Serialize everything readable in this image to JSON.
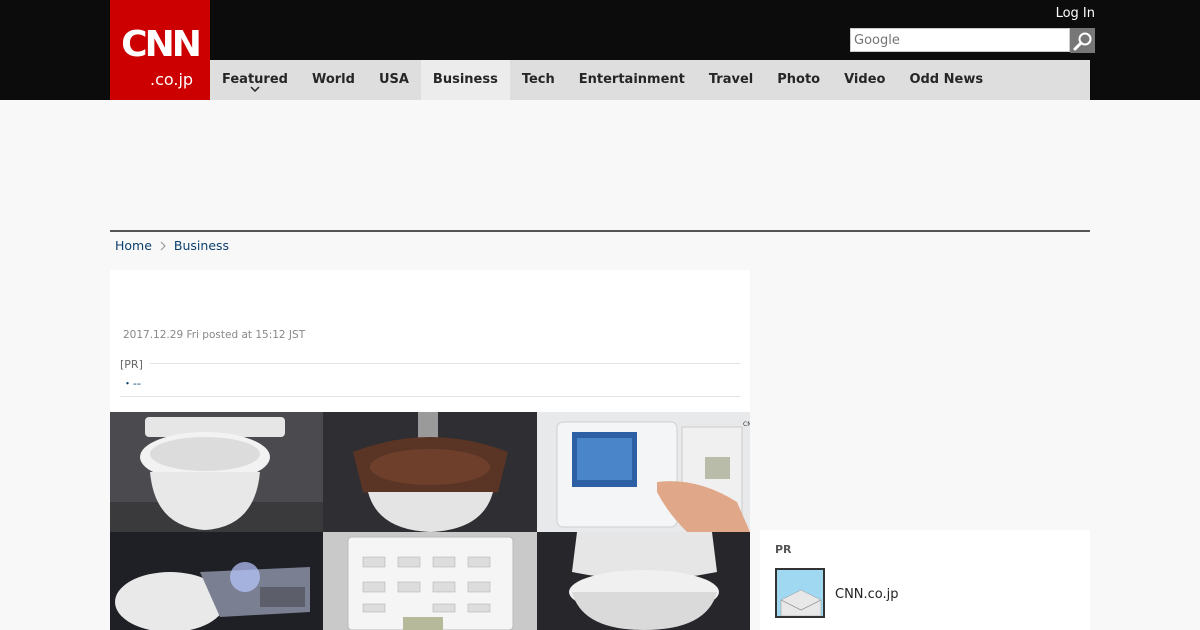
{
  "header": {
    "logo_main": "CNN",
    "logo_sub": ".co.jp",
    "login_label": "Log In",
    "search_placeholder": "Google"
  },
  "nav": {
    "items": [
      {
        "label": "Featured"
      },
      {
        "label": "World"
      },
      {
        "label": "USA"
      },
      {
        "label": "Business"
      },
      {
        "label": "Tech"
      },
      {
        "label": "Entertainment"
      },
      {
        "label": "Travel"
      },
      {
        "label": "Photo"
      },
      {
        "label": "Video"
      },
      {
        "label": "Odd News"
      }
    ],
    "active_index": 3
  },
  "breadcrumb": {
    "home": "Home",
    "section": "Business"
  },
  "article": {
    "date": "2017.12.29 Fri posted at 15:12 JST",
    "pr_label": "[PR]",
    "pr_link": "--",
    "image_watermark": "CNN"
  },
  "sidebar": {
    "pr_label": "PR",
    "pr_item_name": "CNN.co.jp"
  },
  "colors": {
    "brand_red": "#cc0000",
    "header_bg": "#0c0c0c",
    "nav_bg": "#dedede",
    "link_blue": "#0b3f6e"
  }
}
